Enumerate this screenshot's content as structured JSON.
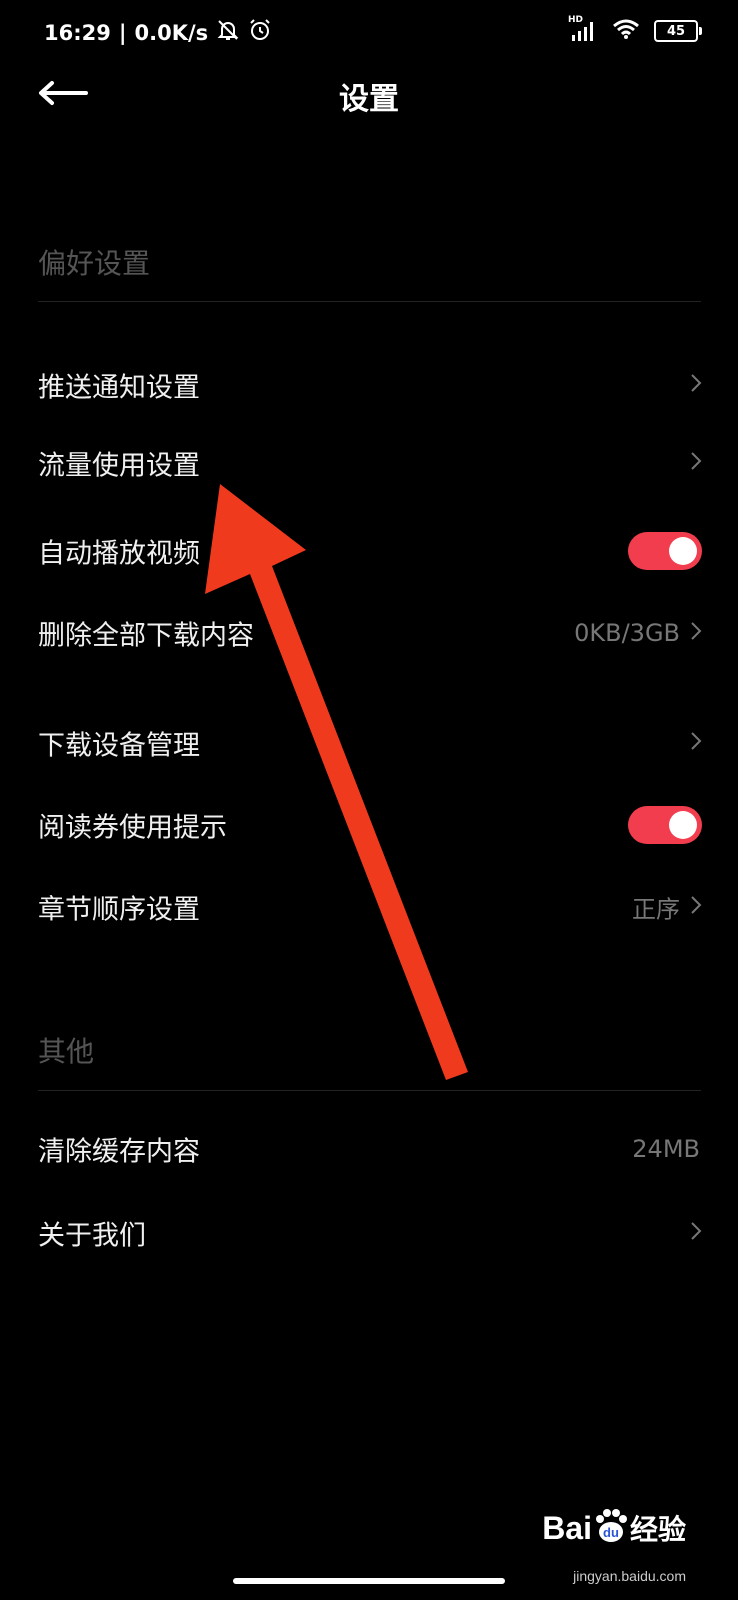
{
  "status_bar": {
    "time": "16:29",
    "separator": "|",
    "net_speed": "0.0K/s",
    "network_badge": "HD",
    "battery": "45"
  },
  "header": {
    "title": "设置"
  },
  "sections": [
    {
      "title": "偏好设置",
      "items": [
        {
          "label": "推送通知设置",
          "control": "chevron"
        },
        {
          "label": "流量使用设置",
          "control": "chevron"
        },
        {
          "label": "自动播放视频",
          "control": "toggle",
          "on": true
        },
        {
          "label": "删除全部下载内容",
          "value": "0KB/3GB",
          "control": "chevron"
        },
        {
          "label": "下载设备管理",
          "control": "chevron"
        },
        {
          "label": "阅读券使用提示",
          "control": "toggle",
          "on": true
        },
        {
          "label": "章节顺序设置",
          "value": "正序",
          "control": "chevron"
        }
      ]
    },
    {
      "title": "其他",
      "items": [
        {
          "label": "清除缓存内容",
          "value": "24MB"
        },
        {
          "label": "关于我们",
          "control": "chevron"
        }
      ]
    }
  ],
  "colors": {
    "accent": "#f23d4f",
    "annotation_arrow": "#f03a1e",
    "background": "#000000"
  },
  "watermark": {
    "brand": "Bai",
    "brand2": "经验",
    "url": "jingyan.baidu.com"
  }
}
